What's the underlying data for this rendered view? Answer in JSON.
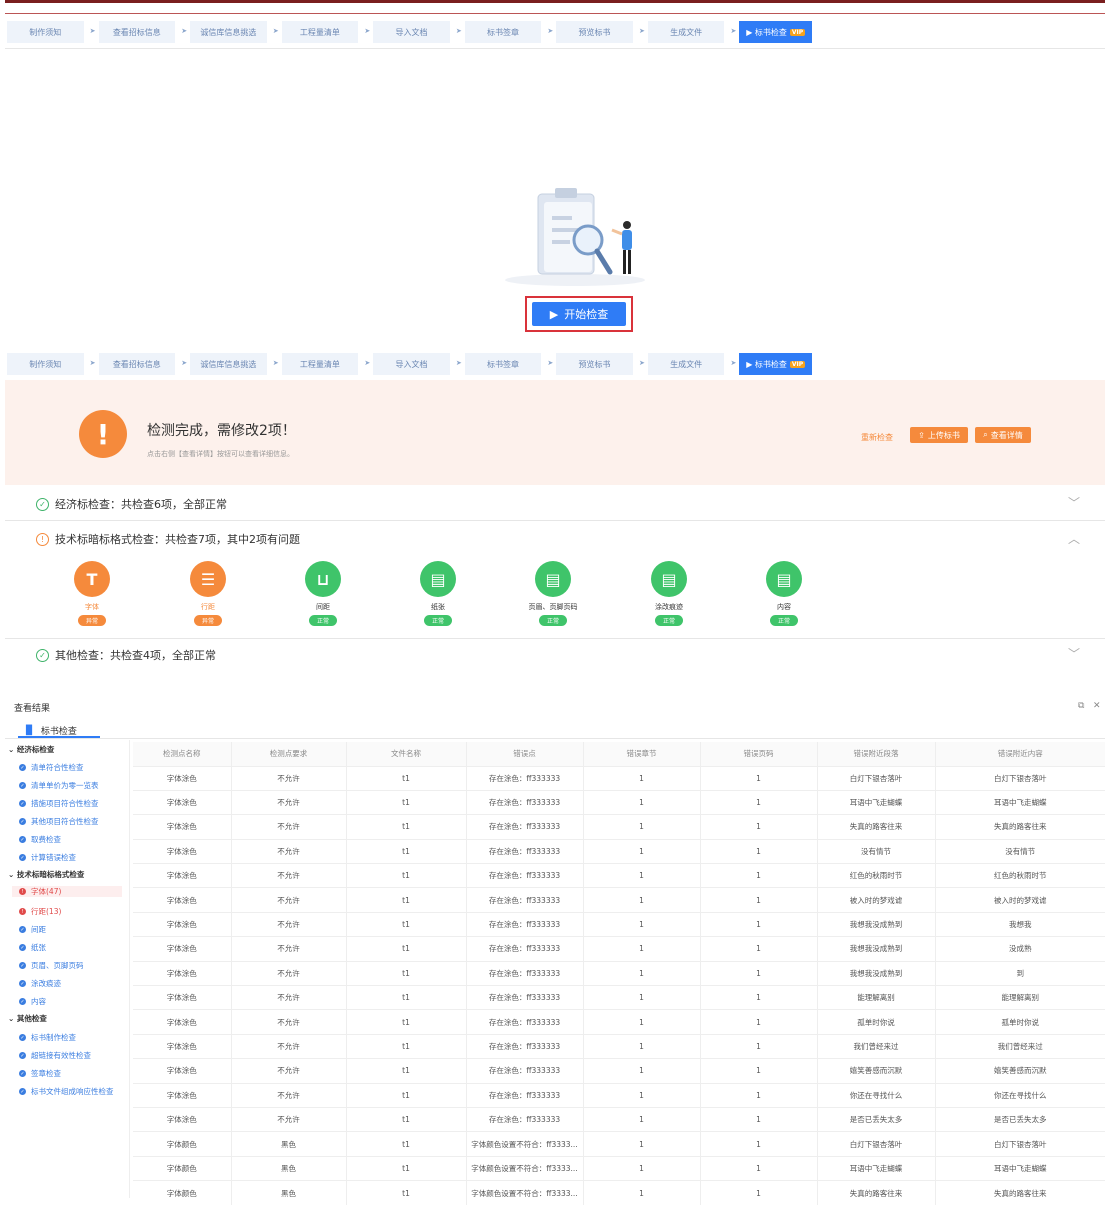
{
  "steps": [
    "制作须知",
    "查看招标信息",
    "诚信库信息挑选",
    "工程量清单",
    "导入文档",
    "标书签章",
    "预览标书",
    "生成文件"
  ],
  "active_step": {
    "label": "标书检查",
    "badge": "VIP"
  },
  "start_button": "开始检查",
  "banner": {
    "title": "检测完成，需修改2项！",
    "subtitle": "点击右侧【查看详情】按钮可以查看详细信息。",
    "recheck": "重新检查",
    "upload": "上传标书",
    "view": "查看详情"
  },
  "checks": {
    "economic": "经济标检查：共检查6项，全部正常",
    "technical": "技术标暗标格式检查：共检查7项，其中2项有问题",
    "other": "其他检查：共检查4项，全部正常"
  },
  "check_items": [
    {
      "label": "字体",
      "status": "异常",
      "icon": "T"
    },
    {
      "label": "行距",
      "status": "异常",
      "icon": "☰"
    },
    {
      "label": "间距",
      "status": "正常",
      "icon": "⊔"
    },
    {
      "label": "纸张",
      "status": "正常",
      "icon": "▤"
    },
    {
      "label": "页眉、页脚页码",
      "status": "正常",
      "icon": "▤"
    },
    {
      "label": "涂改痕迹",
      "status": "正常",
      "icon": "▤"
    },
    {
      "label": "内容",
      "status": "正常",
      "icon": "▤"
    }
  ],
  "colors": {
    "error": "#f58a3c",
    "ok": "#3fc46a",
    "accent": "#2f7cf6"
  },
  "results": {
    "title": "查看结果",
    "tab": "标书检查",
    "tree": {
      "g1": "经济标检查",
      "g1_items": [
        "清单符合性检查",
        "清单单价为零一览表",
        "措施项目符合性检查",
        "其他项目符合性检查",
        "取费检查",
        "计算错误检查"
      ],
      "g2": "技术标暗标格式检查",
      "g2_items": [
        "字体(47)",
        "行距(13)",
        "间距",
        "纸张",
        "页眉、页脚页码",
        "涂改痕迹",
        "内容"
      ],
      "g3": "其他检查",
      "g3_items": [
        "标书制作检查",
        "超链接有效性检查",
        "签章检查",
        "标书文件组成响应性检查"
      ]
    },
    "columns": [
      "检测点名称",
      "检测点要求",
      "文件名称",
      "错误点",
      "错误章节",
      "错误页码",
      "错误附近段落",
      "错误附近内容"
    ],
    "rows": [
      [
        "字体涂色",
        "不允许",
        "t1",
        "存在涂色：ff333333",
        "1",
        "1",
        "白灯下银杏落叶",
        "白灯下银杏落叶"
      ],
      [
        "字体涂色",
        "不允许",
        "t1",
        "存在涂色：ff333333",
        "1",
        "1",
        "耳语中飞走蝴蝶",
        "耳语中飞走蝴蝶"
      ],
      [
        "字体涂色",
        "不允许",
        "t1",
        "存在涂色：ff333333",
        "1",
        "1",
        "失真的路客往来",
        "失真的路客往来"
      ],
      [
        "字体涂色",
        "不允许",
        "t1",
        "存在涂色：ff333333",
        "1",
        "1",
        "没有情节",
        "没有情节"
      ],
      [
        "字体涂色",
        "不允许",
        "t1",
        "存在涂色：ff333333",
        "1",
        "1",
        "红色的秋雨时节",
        "红色的秋雨时节"
      ],
      [
        "字体涂色",
        "不允许",
        "t1",
        "存在涂色：ff333333",
        "1",
        "1",
        "被入时的梦戏谑",
        "被入时的梦戏谑"
      ],
      [
        "字体涂色",
        "不允许",
        "t1",
        "存在涂色：ff333333",
        "1",
        "1",
        "我想我没成熟到",
        "我想我"
      ],
      [
        "字体涂色",
        "不允许",
        "t1",
        "存在涂色：ff333333",
        "1",
        "1",
        "我想我没成熟到",
        "没成熟"
      ],
      [
        "字体涂色",
        "不允许",
        "t1",
        "存在涂色：ff333333",
        "1",
        "1",
        "我想我没成熟到",
        "到"
      ],
      [
        "字体涂色",
        "不允许",
        "t1",
        "存在涂色：ff333333",
        "1",
        "1",
        "能理解离别",
        "能理解离别"
      ],
      [
        "字体涂色",
        "不允许",
        "t1",
        "存在涂色：ff333333",
        "1",
        "1",
        "孤单时你说",
        "孤单时你说"
      ],
      [
        "字体涂色",
        "不允许",
        "t1",
        "存在涂色：ff333333",
        "1",
        "1",
        "我们曾经来过",
        "我们曾经来过"
      ],
      [
        "字体涂色",
        "不允许",
        "t1",
        "存在涂色：ff333333",
        "1",
        "1",
        "嬉笑善感而沉默",
        "嬉笑善感而沉默"
      ],
      [
        "字体涂色",
        "不允许",
        "t1",
        "存在涂色：ff333333",
        "1",
        "1",
        "你还在寻找什么",
        "你还在寻找什么"
      ],
      [
        "字体涂色",
        "不允许",
        "t1",
        "存在涂色：ff333333",
        "1",
        "1",
        "是否已丢失太多",
        "是否已丢失太多"
      ],
      [
        "字体颜色",
        "黑色",
        "t1",
        "字体颜色设置不符合：ff3333...",
        "1",
        "1",
        "白灯下银杏落叶",
        "白灯下银杏落叶"
      ],
      [
        "字体颜色",
        "黑色",
        "t1",
        "字体颜色设置不符合：ff3333...",
        "1",
        "1",
        "耳语中飞走蝴蝶",
        "耳语中飞走蝴蝶"
      ],
      [
        "字体颜色",
        "黑色",
        "t1",
        "字体颜色设置不符合：ff3333...",
        "1",
        "1",
        "失真的路客往来",
        "失真的路客往来"
      ]
    ]
  }
}
